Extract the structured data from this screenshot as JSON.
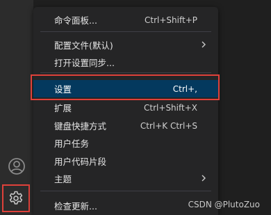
{
  "activity_bar": {
    "account_icon": "account-icon",
    "gear_icon": "gear-icon"
  },
  "menu": {
    "items": [
      {
        "label": "命令面板...",
        "shortcut": "Ctrl+Shift+P"
      },
      {
        "label": "配置文件(默认)",
        "submenu": true
      },
      {
        "label": "打开设置同步..."
      },
      {
        "label": "设置",
        "shortcut": "Ctrl+,",
        "selected": true
      },
      {
        "label": "扩展",
        "shortcut": "Ctrl+Shift+X"
      },
      {
        "label": "键盘快捷方式",
        "shortcut": "Ctrl+K Ctrl+S"
      },
      {
        "label": "用户任务"
      },
      {
        "label": "用户代码片段"
      },
      {
        "label": "主题",
        "submenu": true
      },
      {
        "label": "检查更新..."
      }
    ]
  },
  "watermark": "CSDN @PlutoZuo",
  "colors": {
    "highlight": "#04395e",
    "annotation_border": "#e0413a",
    "menu_bg": "#252526"
  }
}
